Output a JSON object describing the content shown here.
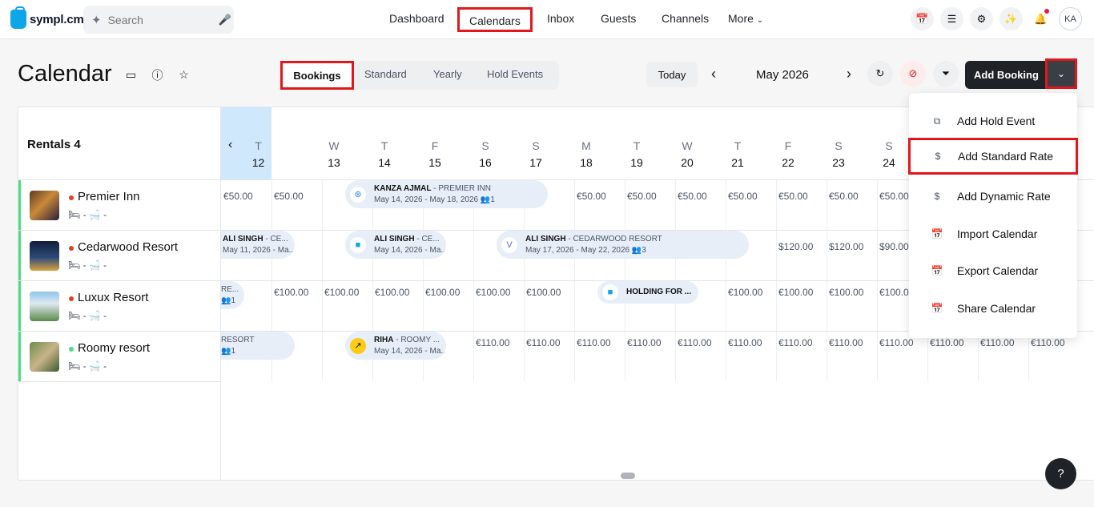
{
  "brand": {
    "name": "sympl.cm"
  },
  "search": {
    "placeholder": "Search"
  },
  "nav": {
    "items": [
      "Dashboard",
      "Calendars",
      "Inbox",
      "Guests",
      "Channels",
      "More"
    ]
  },
  "user": {
    "initials": "KA"
  },
  "page": {
    "title": "Calendar"
  },
  "views": [
    "Bookings",
    "Standard",
    "Yearly",
    "Hold Events"
  ],
  "toolbar": {
    "today": "Today",
    "month": "May 2026",
    "add_booking": "Add Booking"
  },
  "grid": {
    "rentals_label": "Rentals 4",
    "days": [
      {
        "l": "T",
        "n": "12"
      },
      {
        "l": "W",
        "n": "13"
      },
      {
        "l": "T",
        "n": "14"
      },
      {
        "l": "F",
        "n": "15"
      },
      {
        "l": "S",
        "n": "16"
      },
      {
        "l": "S",
        "n": "17"
      },
      {
        "l": "M",
        "n": "18"
      },
      {
        "l": "T",
        "n": "19"
      },
      {
        "l": "W",
        "n": "20"
      },
      {
        "l": "T",
        "n": "21"
      },
      {
        "l": "F",
        "n": "22"
      },
      {
        "l": "S",
        "n": "23"
      },
      {
        "l": "S",
        "n": "24"
      }
    ],
    "rentals": [
      {
        "name": "Premier Inn",
        "meta": "🛏 -   🛁 -",
        "status_color": "#e53e1e"
      },
      {
        "name": "Cedarwood Resort",
        "meta": "🛏 -   🛁 -",
        "status_color": "#e53e1e"
      },
      {
        "name": "Luxux Resort",
        "meta": "🛏 -   🛁 -",
        "status_color": "#e53e1e"
      },
      {
        "name": "Roomy resort",
        "meta": "🛏 -   🛁 -",
        "status_color": "#4ade80"
      }
    ],
    "prices": {
      "r0": [
        "€50.00",
        "€50.00",
        "€50.00",
        "€50.00",
        "€50.00",
        "€50.00",
        "€50.00",
        "€50.00",
        "€50.00"
      ],
      "r1": [
        "$120.00",
        "$120.00",
        "$90.00"
      ],
      "r2": [
        "€100.00",
        "€100.00",
        "€100.00",
        "€100.00",
        "€100.00",
        "€100.00",
        "€100.00",
        "€100.00",
        "€100.00",
        "€100.0"
      ],
      "r3": [
        "€110.00",
        "€110.00",
        "€110.00",
        "€110.00",
        "€110.00",
        "€110.00",
        "€110.00",
        "€110.00",
        "€110.00",
        "€110.00",
        "€110.00",
        "€110.00"
      ]
    },
    "bookings": {
      "kanza": {
        "guest": "KANZA AJMAL",
        "property": " - PREMIER INN",
        "dates": "May 14, 2026 - May 18, 2026",
        "guests": "1"
      },
      "ali1": {
        "guest": "ALI SINGH",
        "property": " - CE...",
        "dates": "May 11, 2026 - Ma..."
      },
      "ali2": {
        "guest": "ALI SINGH",
        "property": " - CE...",
        "dates": "May 14, 2026 - Ma..."
      },
      "ali3": {
        "guest": "ALI SINGH",
        "property": " - CEDARWOOD RESORT",
        "dates": "May 17, 2026 - May 22, 2026",
        "guests": "3"
      },
      "luxux_partial": {
        "guest": "RE...",
        "guests": "1"
      },
      "holding": {
        "guest": "HOLDING FOR ..."
      },
      "roomy_partial": {
        "guest": "RESORT",
        "guests": "1"
      },
      "riha": {
        "guest": "RIHA",
        "property": " - ROOMY ...",
        "dates": "May 14, 2026 - Ma..."
      }
    }
  },
  "dropdown": {
    "items": [
      "Add Hold Event",
      "Add Standard Rate",
      "Add Dynamic Rate",
      "Import Calendar",
      "Export Calendar",
      "Share Calendar"
    ]
  },
  "help": {
    "label": "?"
  }
}
